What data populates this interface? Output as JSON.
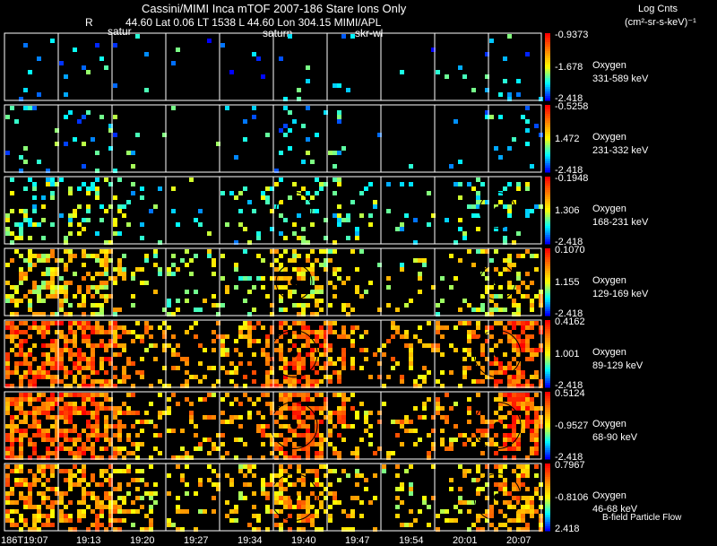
{
  "header": {
    "title_line": "Cassini/MIMI Inca mTOF  2007-186   Stare    Ions Only",
    "r_label": "R",
    "position_line": "44.60 Lat 0.06 LT 1538 L         44.60 Lon        304.15  MIMI/APL",
    "units_title": "Log Cnts",
    "units": "(cm²-sr-s-keV)⁻¹"
  },
  "sub_markers": [
    "satur",
    "saturn",
    "skr-wl"
  ],
  "footer_label": "B-field Particle Flow",
  "chart_data": {
    "type": "heatmap",
    "x_ticks": [
      "186T19:07",
      "19:13",
      "19:20",
      "19:27",
      "19:34",
      "19:40",
      "19:47",
      "19:54",
      "20:01",
      "20:07"
    ],
    "colorscale": [
      "#0000ff",
      "#00ffff",
      "#ffff00",
      "#ff0000"
    ],
    "panels": [
      {
        "species": "Oxygen",
        "energy": "331-589 keV",
        "cbar_max": "-0.9373",
        "cbar_mid": "-1.678",
        "cbar_min": "-2.418",
        "density": 0.04
      },
      {
        "species": "Oxygen",
        "energy": "231-332 keV",
        "cbar_max": "-0.5258",
        "cbar_mid": "1.472",
        "cbar_min": "-2.418",
        "density": 0.08
      },
      {
        "species": "Oxygen",
        "energy": "168-231 keV",
        "cbar_max": "-0.1948",
        "cbar_mid": "1.306",
        "cbar_min": "-2.418",
        "density": 0.18
      },
      {
        "species": "Oxygen",
        "energy": "129-169 keV",
        "cbar_max": "0.1070",
        "cbar_mid": "1.155",
        "cbar_min": "-2.418",
        "density": 0.35
      },
      {
        "species": "Oxygen",
        "energy": "89-129 keV",
        "cbar_max": "0.4162",
        "cbar_mid": "1.001",
        "cbar_min": "-2.418",
        "density": 0.55
      },
      {
        "species": "Oxygen",
        "energy": "68-90 keV",
        "cbar_max": "0.5124",
        "cbar_mid": "-0.9527",
        "cbar_min": "-2.418",
        "density": 0.55
      },
      {
        "species": "Oxygen",
        "energy": "46-68 keV",
        "cbar_max": "0.7967",
        "cbar_mid": "-0.8106",
        "cbar_min": "2.418",
        "density": 0.45
      }
    ]
  }
}
